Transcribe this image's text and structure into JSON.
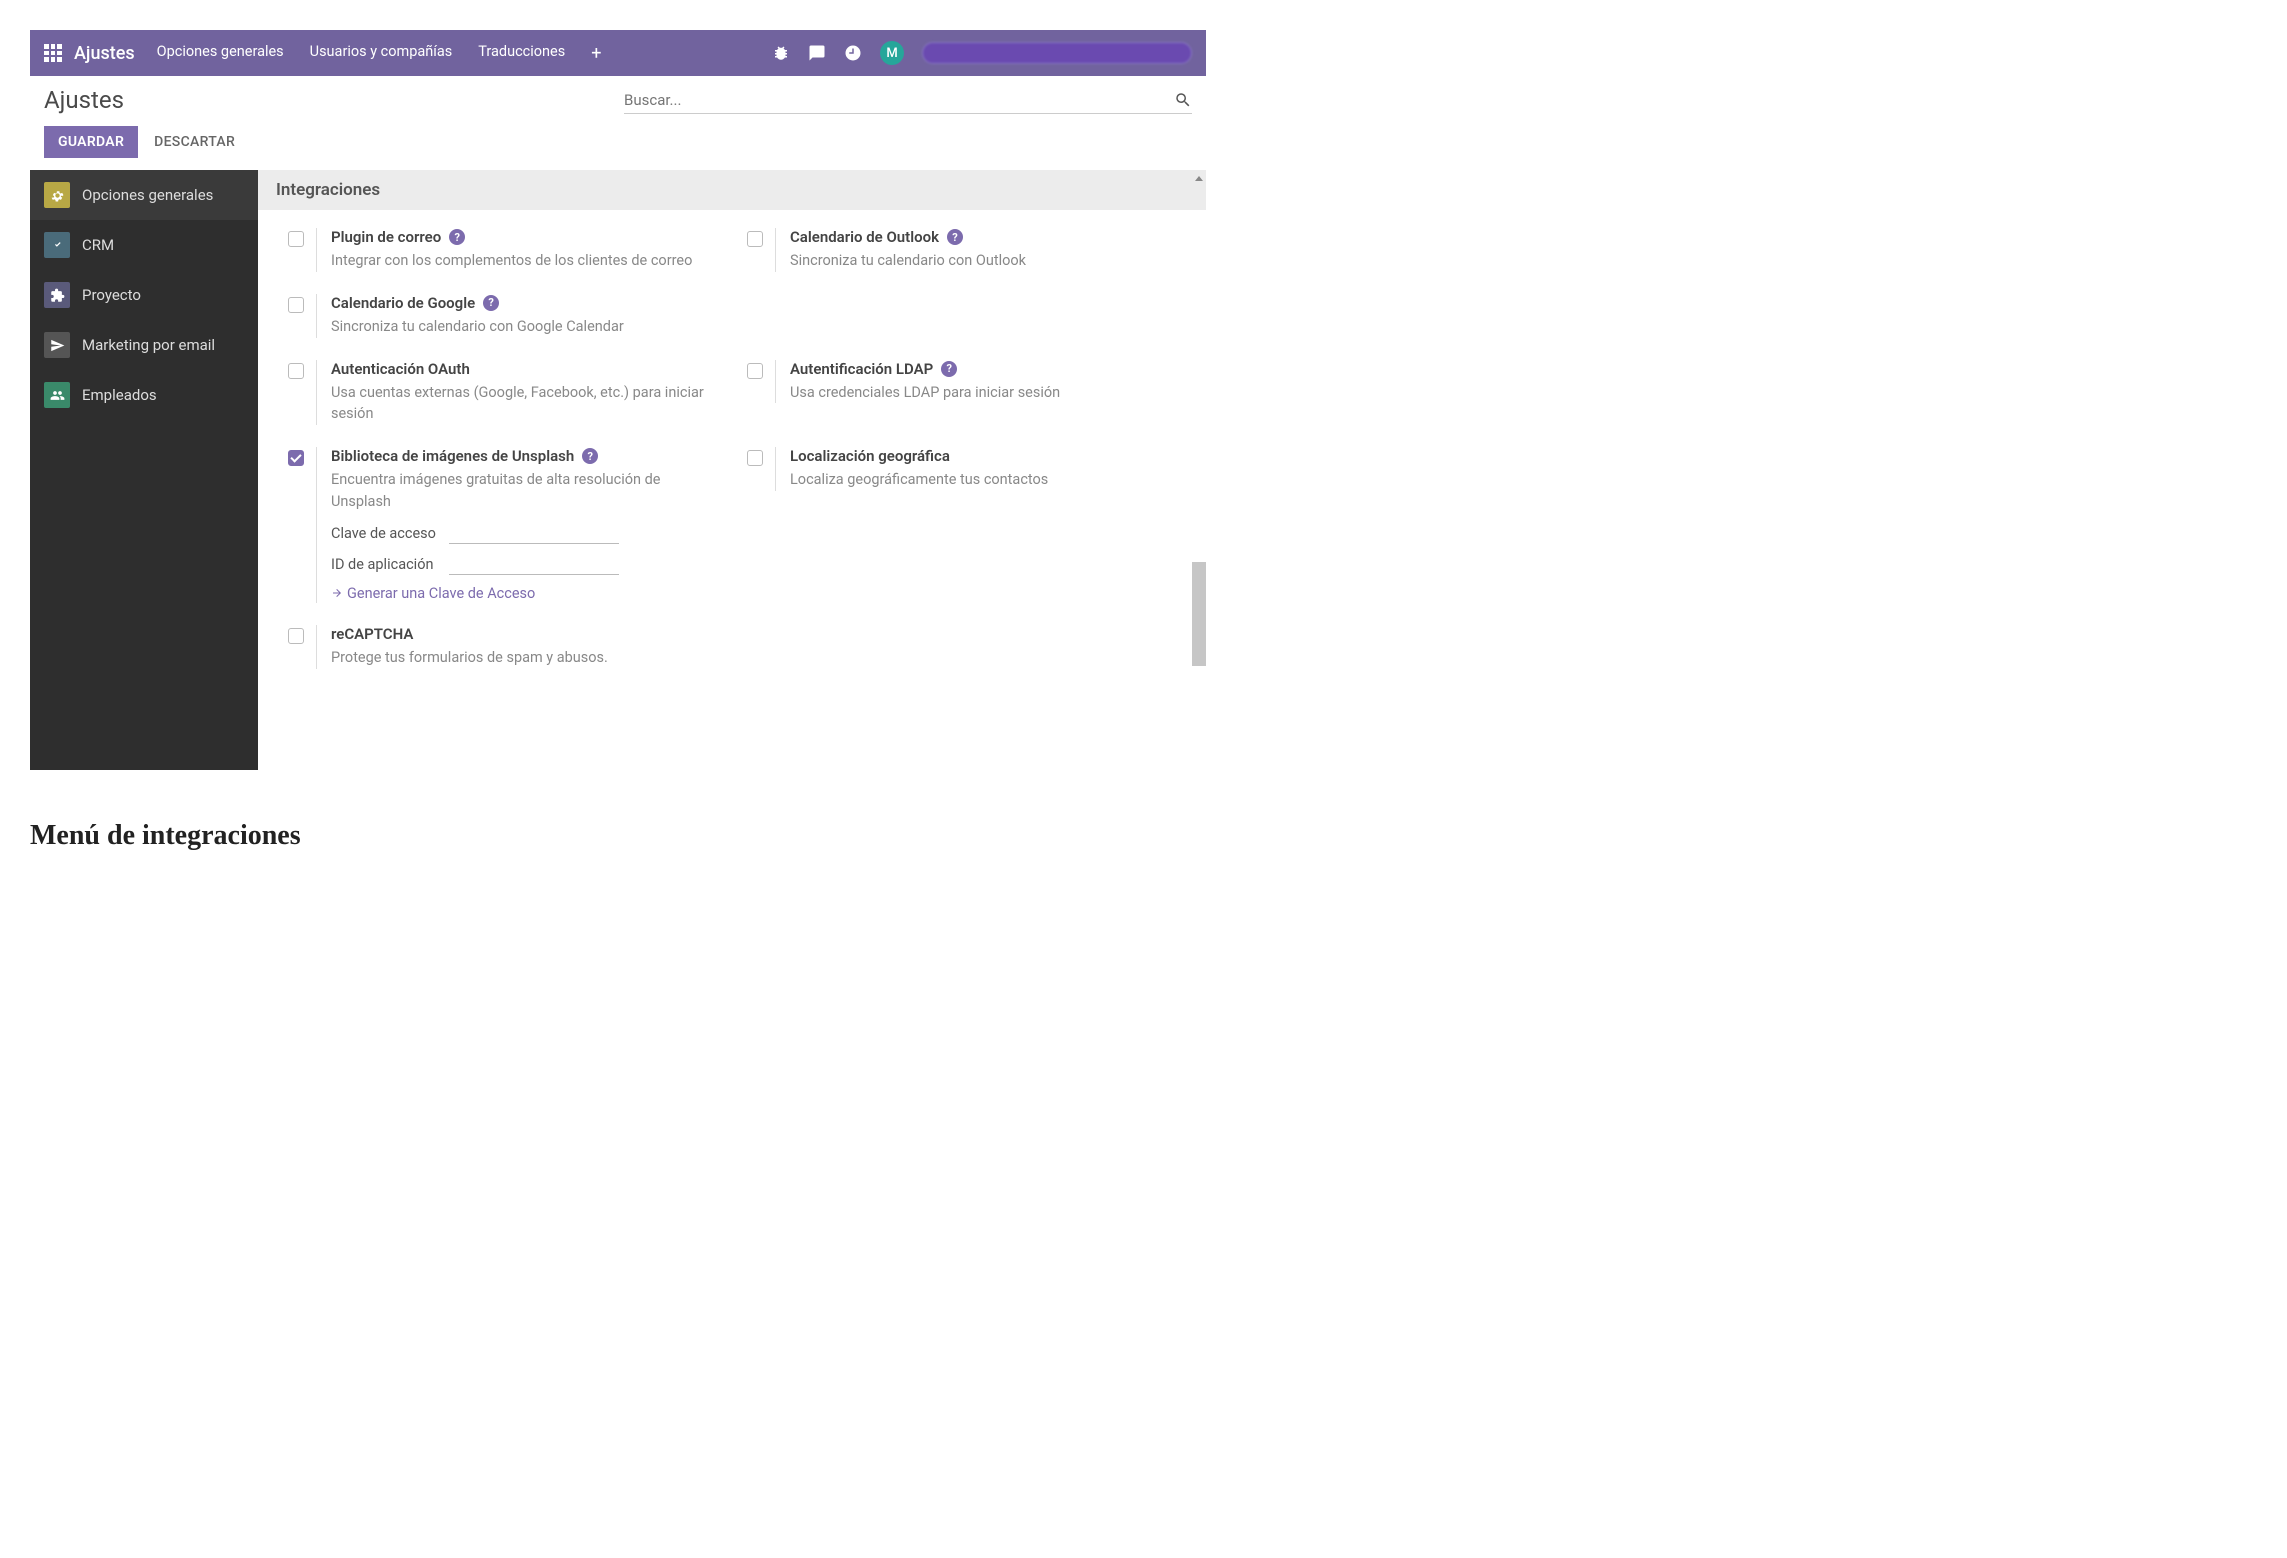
{
  "topbar": {
    "app_title": "Ajustes",
    "menu": [
      "Opciones generales",
      "Usuarios y compañías",
      "Traducciones"
    ],
    "avatar_letter": "M"
  },
  "subhead": {
    "page_title": "Ajustes",
    "search_placeholder": "Buscar..."
  },
  "buttons": {
    "save": "GUARDAR",
    "discard": "DESCARTAR"
  },
  "sidebar": {
    "items": [
      {
        "label": "Opciones generales",
        "icon": "gear",
        "active": true
      },
      {
        "label": "CRM",
        "icon": "crm",
        "active": false
      },
      {
        "label": "Proyecto",
        "icon": "proj",
        "active": false
      },
      {
        "label": "Marketing por email",
        "icon": "mail",
        "active": false
      },
      {
        "label": "Empleados",
        "icon": "emp",
        "active": false
      }
    ]
  },
  "section": {
    "title": "Integraciones"
  },
  "options": {
    "mail_plugin": {
      "title": "Plugin de correo",
      "desc": "Integrar con los complementos de los clientes de correo",
      "help": true,
      "checked": false
    },
    "outlook_cal": {
      "title": "Calendario de Outlook",
      "desc": "Sincroniza tu calendario con Outlook",
      "help": true,
      "checked": false
    },
    "google_cal": {
      "title": "Calendario de Google",
      "desc": "Sincroniza tu calendario con Google Calendar",
      "help": true,
      "checked": false
    },
    "oauth": {
      "title": "Autenticación OAuth",
      "desc": "Usa cuentas externas (Google, Facebook, etc.) para iniciar sesión",
      "help": false,
      "checked": false
    },
    "ldap": {
      "title": "Autentificación LDAP",
      "desc": "Usa credenciales LDAP para iniciar sesión",
      "help": true,
      "checked": false
    },
    "unsplash": {
      "title": "Biblioteca de imágenes de Unsplash",
      "desc": "Encuentra imágenes gratuitas de alta resolución de Unsplash",
      "help": true,
      "checked": true,
      "access_key_label": "Clave de acceso",
      "app_id_label": "ID de aplicación",
      "gen_link": "Generar una Clave de Acceso"
    },
    "geo": {
      "title": "Localización geográfica",
      "desc": "Localiza geográficamente tus contactos",
      "help": false,
      "checked": false
    },
    "recaptcha": {
      "title": "reCAPTCHA",
      "desc": "Protege tus formularios de spam y abusos.",
      "help": false,
      "checked": false
    }
  },
  "caption": "Menú de integraciones"
}
